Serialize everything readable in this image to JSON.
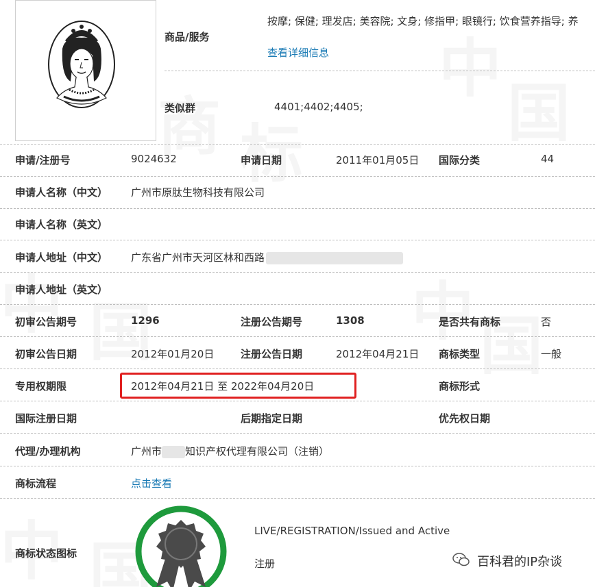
{
  "goods_services": {
    "label": "商品/服务",
    "value": "按摩; 保健; 理发店; 美容院; 文身; 修指甲; 眼镜行; 饮食营养指导; 养",
    "detail_link": "查看详细信息"
  },
  "similar_group": {
    "label": "类似群",
    "value": "4401;4402;4405;"
  },
  "rows": {
    "reg_no": {
      "label": "申请/注册号",
      "value": "9024632"
    },
    "apply_date": {
      "label": "申请日期",
      "value": "2011年01月05日"
    },
    "intl_class": {
      "label": "国际分类",
      "value": "44"
    },
    "applicant_cn": {
      "label": "申请人名称（中文）",
      "value": "广州市原肽生物科技有限公司"
    },
    "applicant_en": {
      "label": "申请人名称（英文）",
      "value": ""
    },
    "address_cn": {
      "label": "申请人地址（中文）",
      "value": "广东省广州市天河区林和西路"
    },
    "address_en": {
      "label": "申请人地址（英文）",
      "value": ""
    },
    "prelim_issue": {
      "label": "初审公告期号",
      "value": "1296"
    },
    "reg_issue": {
      "label": "注册公告期号",
      "value": "1308"
    },
    "shared": {
      "label": "是否共有商标",
      "value": "否"
    },
    "prelim_date": {
      "label": "初审公告日期",
      "value": "2012年01月20日"
    },
    "reg_date": {
      "label": "注册公告日期",
      "value": "2012年04月21日"
    },
    "tm_type": {
      "label": "商标类型",
      "value": "一般"
    },
    "exclusive_period": {
      "label": "专用权期限",
      "value": "2012年04月21日 至 2022年04月20日"
    },
    "tm_form": {
      "label": "商标形式",
      "value": ""
    },
    "intl_reg_date": {
      "label": "国际注册日期",
      "value": ""
    },
    "later_designation": {
      "label": "后期指定日期",
      "value": ""
    },
    "priority_date": {
      "label": "优先权日期",
      "value": ""
    },
    "agent": {
      "label": "代理/办理机构",
      "value_prefix": "广州市",
      "value_suffix": "知识产权代理有限公司（注销）"
    },
    "process": {
      "label": "商标流程",
      "link": "点击查看"
    },
    "status": {
      "label": "商标状态图标",
      "line1": "LIVE/REGISTRATION/Issued and Active",
      "line2": "注册"
    }
  },
  "watermark_credit": "百科君的IP杂谈",
  "colors": {
    "link": "#1b7bb5",
    "highlight_box": "#e02020",
    "status_ring": "#1e9a3c",
    "divider": "#bdbdbd"
  },
  "icons": {
    "trademark_image": "queen-portrait-oval",
    "status_icon": "award-rosette-icon",
    "credit_icon": "wechat-icon"
  }
}
